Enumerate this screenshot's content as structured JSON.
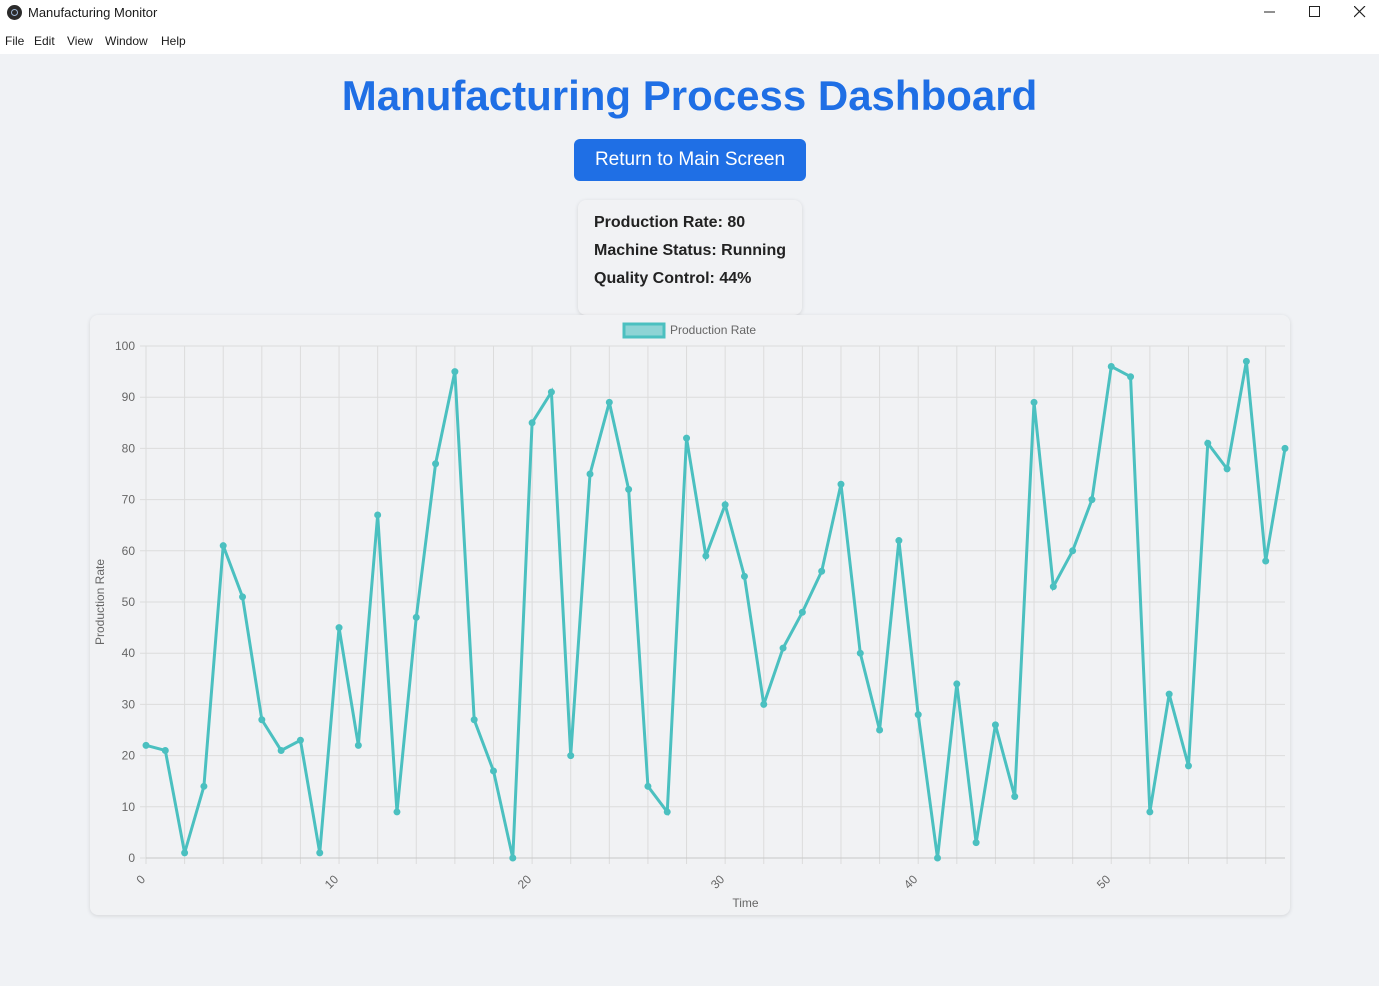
{
  "window": {
    "title": "Manufacturing Monitor"
  },
  "menu": [
    "File",
    "Edit",
    "View",
    "Window",
    "Help"
  ],
  "header": {
    "title": "Manufacturing Process Dashboard",
    "return_button": "Return to Main Screen"
  },
  "stats": [
    "Production Rate: 80",
    "Machine Status: Running",
    "Quality Control: 44%"
  ],
  "colors": {
    "accent": "#1f6fe5",
    "series": "#4bc0c0"
  },
  "chart_data": {
    "type": "line",
    "legend": "Production Rate",
    "legend_position": "top",
    "xlabel": "Time",
    "ylabel": "Production Rate",
    "grid": true,
    "ylim": [
      0,
      100
    ],
    "yticks": [
      0,
      10,
      20,
      30,
      40,
      50,
      60,
      70,
      80,
      90,
      100
    ],
    "xticks": [
      0,
      10,
      20,
      30,
      40,
      50
    ],
    "x": [
      0,
      1,
      2,
      3,
      4,
      5,
      6,
      7,
      8,
      9,
      10,
      11,
      12,
      13,
      14,
      15,
      16,
      17,
      18,
      19,
      20,
      21,
      22,
      23,
      24,
      25,
      26,
      27,
      28,
      29,
      30,
      31,
      32,
      33,
      34,
      35,
      36,
      37,
      38,
      39,
      40,
      41,
      42,
      43,
      44,
      45,
      46,
      47,
      48,
      49,
      50,
      51,
      52,
      53,
      54,
      55,
      56,
      57,
      58,
      59
    ],
    "values": [
      22,
      21,
      1,
      14,
      61,
      51,
      27,
      21,
      23,
      1,
      45,
      22,
      67,
      9,
      47,
      77,
      95,
      27,
      17,
      0,
      85,
      91,
      20,
      75,
      89,
      72,
      14,
      9,
      82,
      59,
      69,
      55,
      30,
      41,
      48,
      56,
      73,
      40,
      25,
      62,
      28,
      0,
      34,
      3,
      26,
      12,
      89,
      53,
      60,
      70,
      96,
      94,
      9,
      32,
      18,
      81,
      76,
      97,
      58,
      80
    ]
  }
}
